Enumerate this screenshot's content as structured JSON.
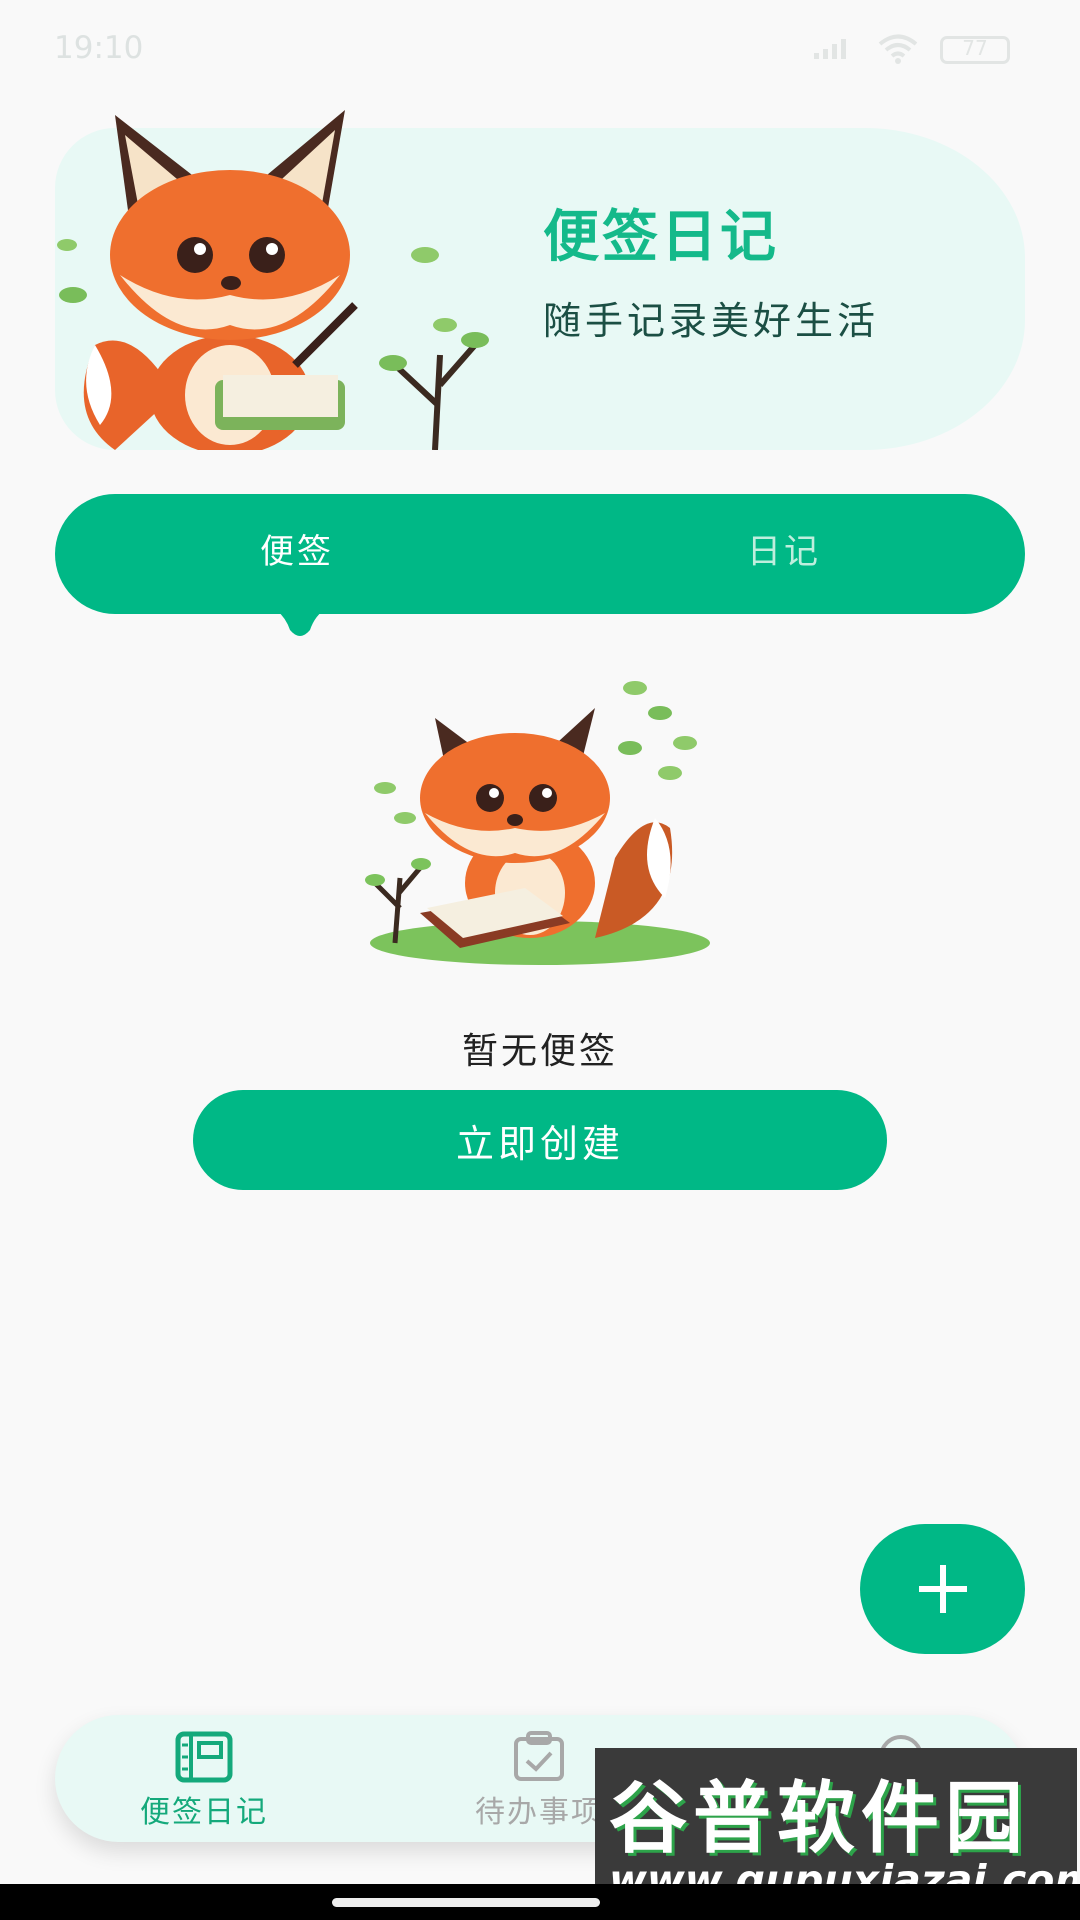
{
  "status_bar": {
    "time": "19:10",
    "battery": "77"
  },
  "header": {
    "title": "便签日记",
    "subtitle": "随手记录美好生活"
  },
  "tabs": [
    {
      "label": "便签"
    },
    {
      "label": "日记"
    }
  ],
  "empty_state": {
    "message": "暂无便签",
    "button": "立即创建"
  },
  "fab": {
    "icon": "plus-icon"
  },
  "bottom_nav": [
    {
      "label": "便签日记",
      "icon": "notebook-icon",
      "active": true
    },
    {
      "label": "待办事项",
      "icon": "clipboard-check-icon",
      "active": false
    },
    {
      "label": "",
      "icon": "profile-icon",
      "active": false
    }
  ],
  "watermark": {
    "title": "谷普软件园",
    "url": "www.gupuxiazai.com"
  },
  "colors": {
    "accent": "#00b886",
    "banner_bg": "#e8f9f5",
    "page_bg": "#f9f9f9"
  }
}
